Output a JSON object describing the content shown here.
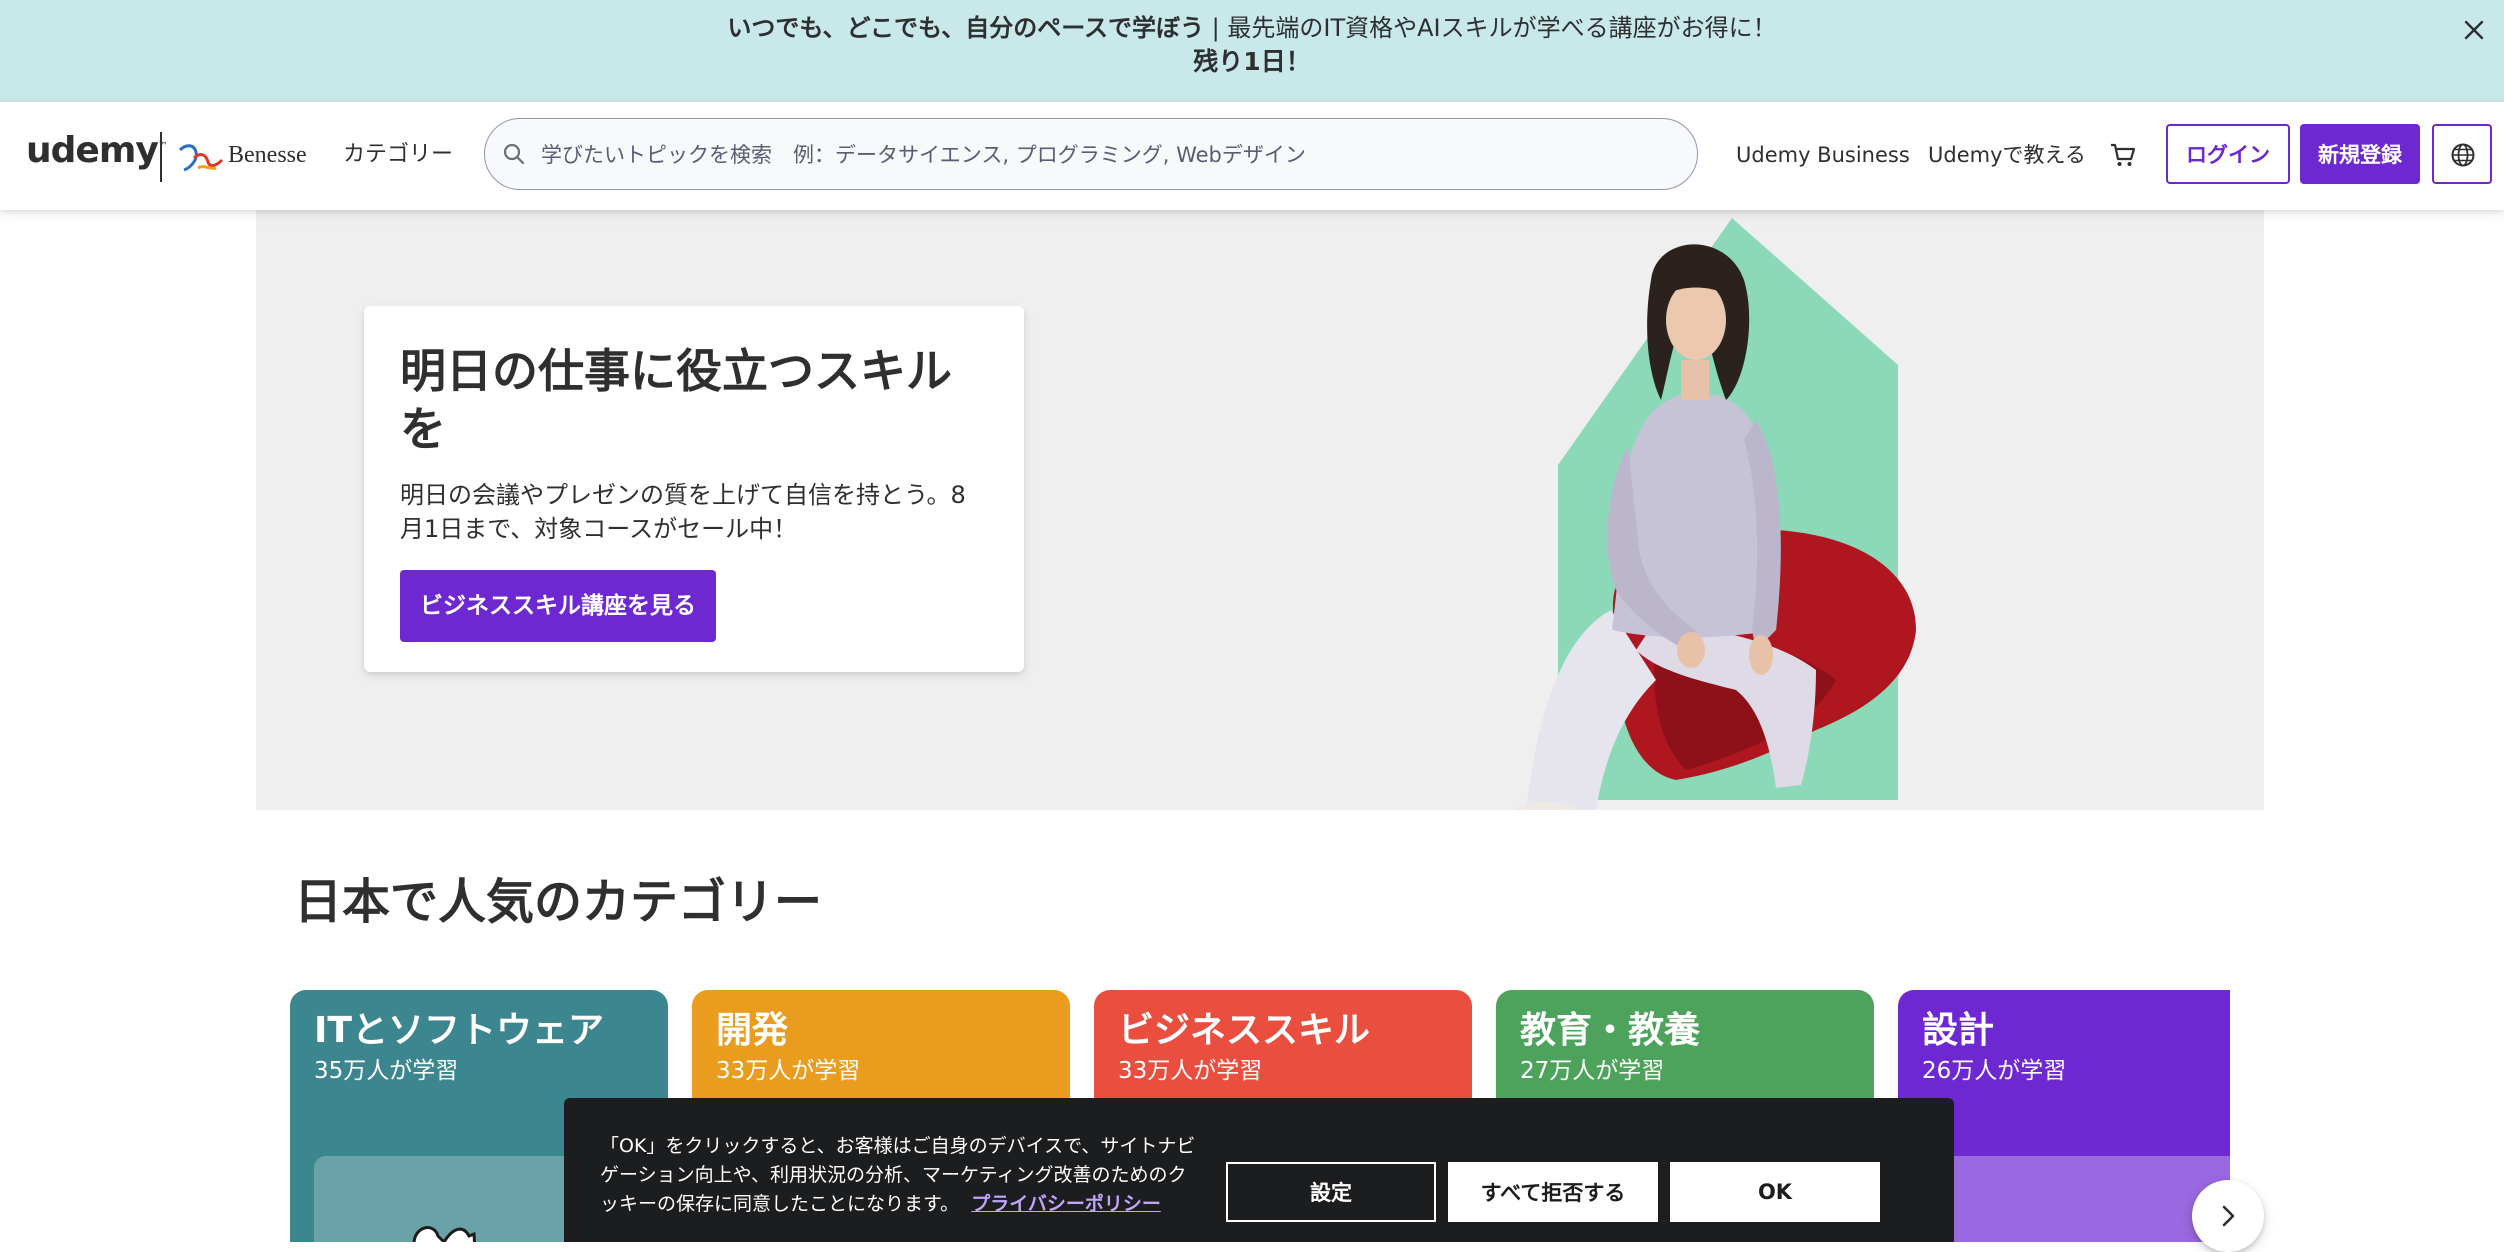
{
  "banner": {
    "bold_text": "いつでも、どこでも、自分のペースで学ぼう",
    "text": " | 最先端のIT資格やAIスキルが学べる講座がお得に！",
    "countdown": "残り1日！",
    "close_icon": "close-icon"
  },
  "header": {
    "logo_udemy": "udemy",
    "logo_tm": "™",
    "logo_benesse": "Benesse",
    "categories": "カテゴリー",
    "search_placeholder": "学びたいトピックを検索　例：データサイエンス, プログラミング, Webデザイン",
    "udemy_business": "Udemy Business",
    "teach": "Udemyで教える",
    "cart_icon": "cart-icon",
    "login": "ログイン",
    "signup": "新規登録",
    "language_icon": "globe-icon"
  },
  "hero": {
    "title": "明日の仕事に役立つスキルを",
    "text": "明日の会議やプレゼンの質を上げて自信を持とう。8月1日まで、対象コースがセール中！",
    "cta": "ビジネススキル講座を見る"
  },
  "categories": {
    "title": "日本で人気のカテゴリー",
    "items": [
      {
        "name": "ITとソフトウェア",
        "count": "35万人が学習",
        "color": "#3c868f",
        "inner": "#6ba2aa"
      },
      {
        "name": "開発",
        "count": "33万人が学習",
        "color": "#e99c1d",
        "inner": "#f2bd63"
      },
      {
        "name": "ビジネススキル",
        "count": "33万人が学習",
        "color": "#ea4e3f",
        "inner": "#f2867b"
      },
      {
        "name": "教育・教養",
        "count": "27万人が学習",
        "color": "#4da35c",
        "inner": "#82c08c"
      },
      {
        "name": "設計",
        "count": "26万人が学習",
        "color": "#6d28d2",
        "inner": "#9a68e0"
      }
    ],
    "next_icon": "chevron-right-icon"
  },
  "cookie": {
    "text": "「OK」をクリックすると、お客様はご自身のデバイスで、サイトナビゲーション向上や、利用状況の分析、マーケティング改善のためのクッキーの保存に同意したことになります。",
    "link": "プライバシーポリシー",
    "settings": "設定",
    "reject_all": "すべて拒否する",
    "ok": "OK"
  }
}
